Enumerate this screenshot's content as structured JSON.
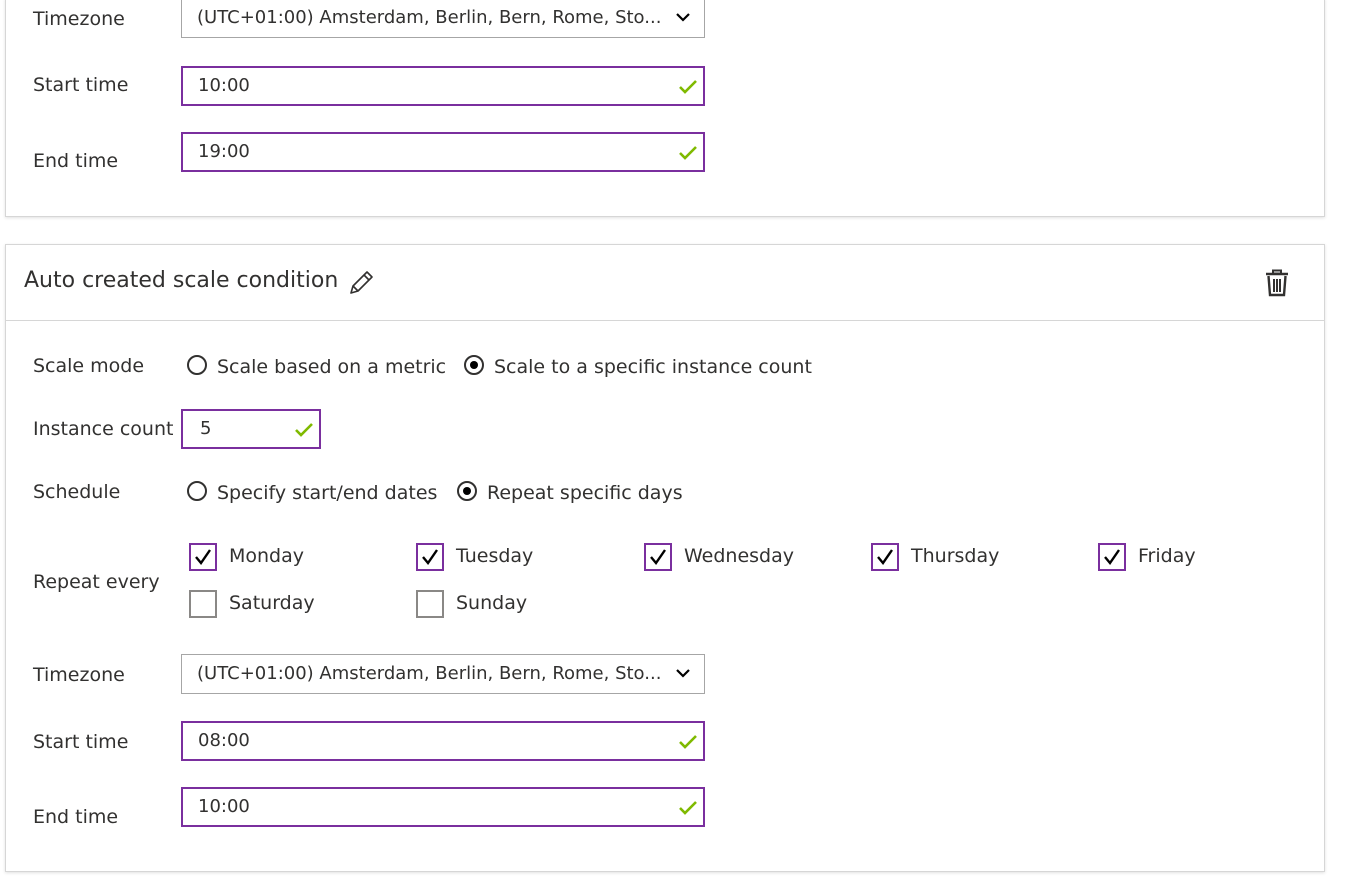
{
  "top_panel": {
    "timezone_label": "Timezone",
    "timezone_value": "(UTC+01:00) Amsterdam, Berlin, Bern, Rome, Sto...",
    "start_time_label": "Start time",
    "start_time_value": "10:00",
    "end_time_label": "End time",
    "end_time_value": "19:00"
  },
  "condition": {
    "title": "Auto created scale condition",
    "scale_mode_label": "Scale mode",
    "scale_mode_options": [
      "Scale based on a metric",
      "Scale to a specific instance count"
    ],
    "scale_mode_selected": "Scale to a specific instance count",
    "instance_count_label": "Instance count",
    "instance_count_value": "5",
    "schedule_label": "Schedule",
    "schedule_options": [
      "Specify start/end dates",
      "Repeat specific days"
    ],
    "schedule_selected": "Repeat specific days",
    "repeat_every_label": "Repeat every",
    "days": [
      {
        "label": "Monday",
        "checked": true
      },
      {
        "label": "Tuesday",
        "checked": true
      },
      {
        "label": "Wednesday",
        "checked": true
      },
      {
        "label": "Thursday",
        "checked": true
      },
      {
        "label": "Friday",
        "checked": true
      },
      {
        "label": "Saturday",
        "checked": false
      },
      {
        "label": "Sunday",
        "checked": false
      }
    ],
    "timezone_label": "Timezone",
    "timezone_value": "(UTC+01:00) Amsterdam, Berlin, Bern, Rome, Sto...",
    "start_time_label": "Start time",
    "start_time_value": "08:00",
    "end_time_label": "End time",
    "end_time_value": "10:00"
  },
  "colors": {
    "focus_border": "#7a2f9e",
    "valid_check": "#7fba00",
    "neutral_border": "#a6a6a6"
  },
  "icons": {
    "dropdown": "chevron-down-icon",
    "valid": "checkmark-icon",
    "edit": "pencil-icon",
    "delete": "trash-icon"
  }
}
